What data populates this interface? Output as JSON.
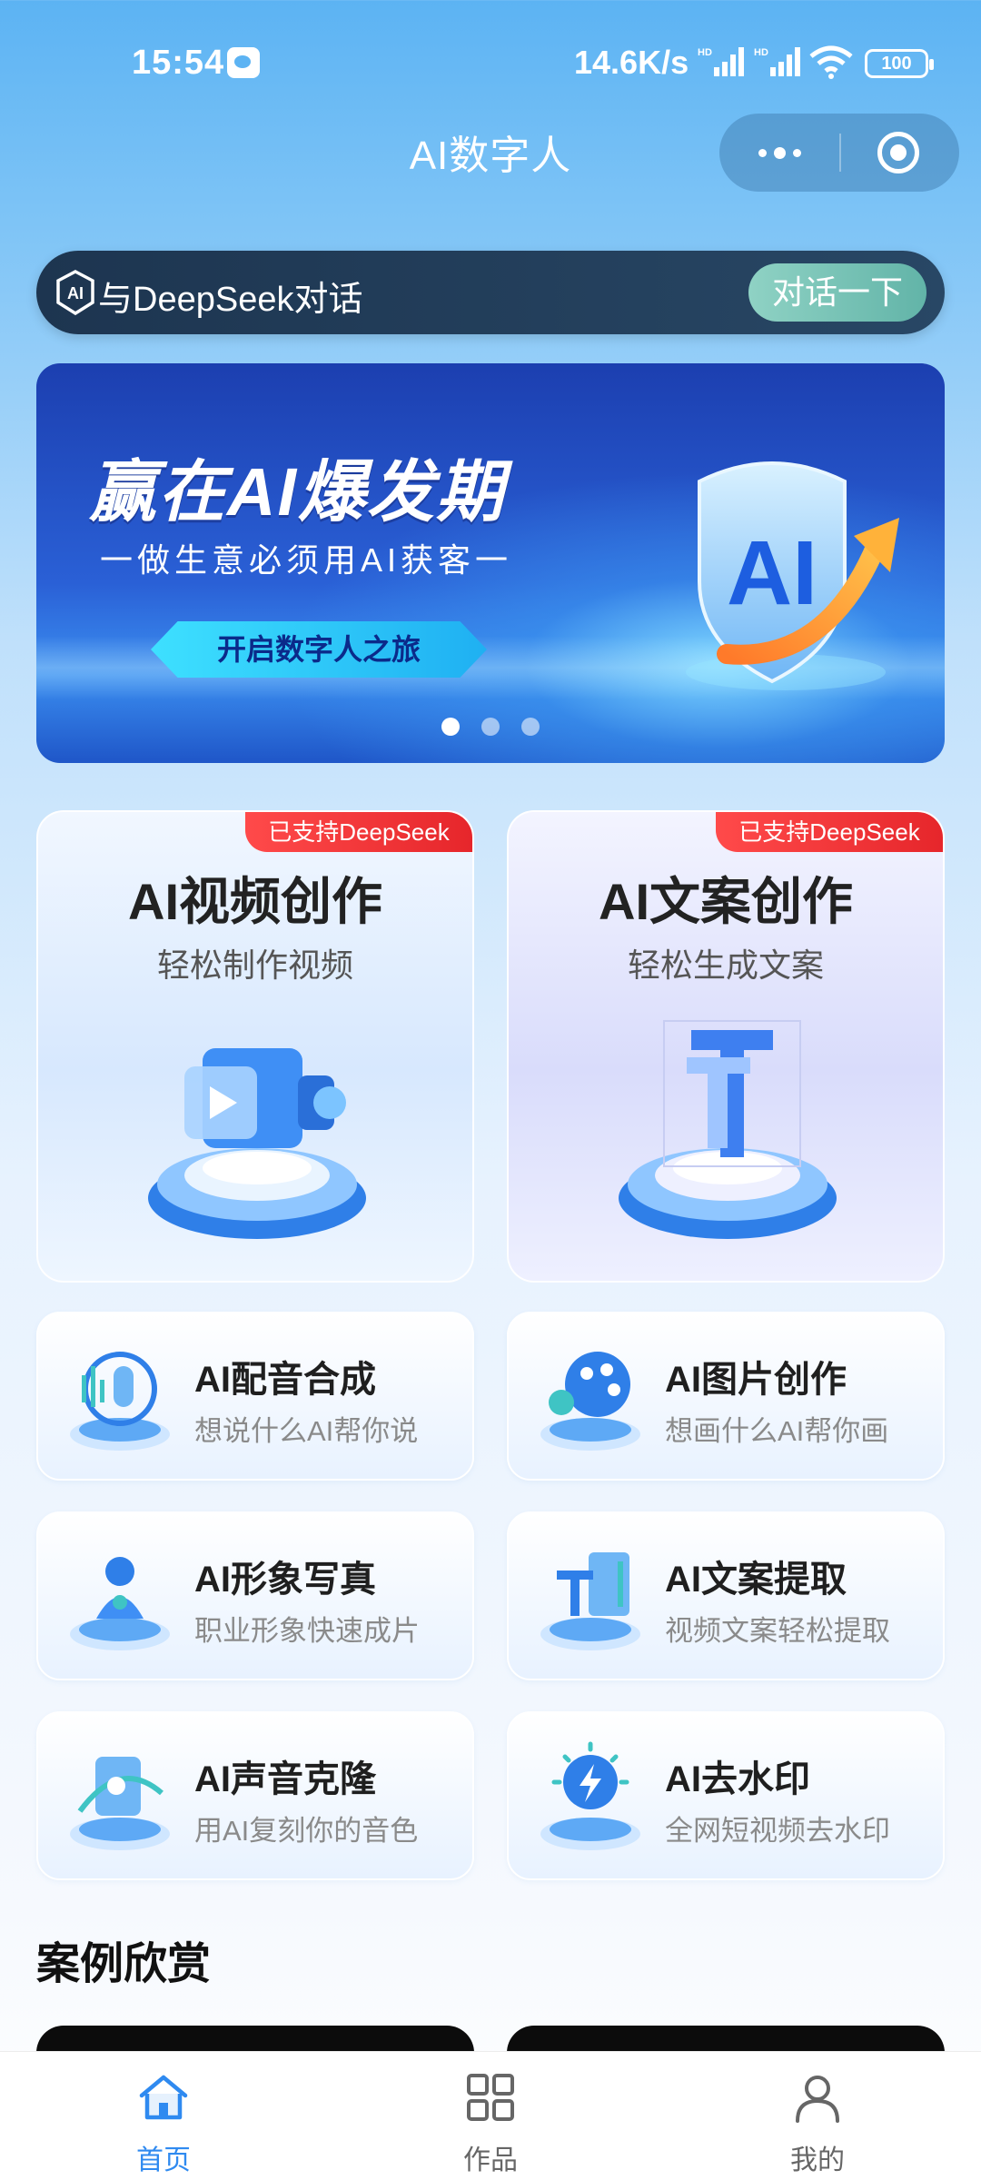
{
  "status_bar": {
    "time": "15:54",
    "net_speed": "14.6K/s",
    "sim1_tag": "HD",
    "sim2_tag": "HD",
    "battery": "100"
  },
  "nav": {
    "title": "AI数字人"
  },
  "deepseek": {
    "label": "与DeepSeek对话",
    "button": "对话一下"
  },
  "banner": {
    "title": "赢在AI爆发期",
    "subtitle": "一做生意必须用AI获客一",
    "button": "开启数字人之旅",
    "shield_text": "AI",
    "page_count": 3,
    "active_page": 1
  },
  "big_cards": [
    {
      "badge": "已支持DeepSeek",
      "title": "AI视频创作",
      "subtitle": "轻松制作视频",
      "icon": "video-camera-icon"
    },
    {
      "badge": "已支持DeepSeek",
      "title": "AI文案创作",
      "subtitle": "轻松生成文案",
      "icon": "text-t-icon"
    }
  ],
  "small_cards": [
    {
      "title": "AI配音合成",
      "subtitle": "想说什么AI帮你说",
      "icon": "microphone-icon"
    },
    {
      "title": "AI图片创作",
      "subtitle": "想画什么AI帮你画",
      "icon": "palette-icon"
    },
    {
      "title": "AI形象写真",
      "subtitle": "职业形象快速成片",
      "icon": "person-icon"
    },
    {
      "title": "AI文案提取",
      "subtitle": "视频文案轻松提取",
      "icon": "text-extract-icon"
    },
    {
      "title": "AI声音克隆",
      "subtitle": "用AI复刻你的音色",
      "icon": "voice-clone-icon"
    },
    {
      "title": "AI去水印",
      "subtitle": "全网短视频去水印",
      "icon": "watermark-remove-icon"
    }
  ],
  "cases": {
    "title": "案例欣赏"
  },
  "tabs": [
    {
      "label": "首页",
      "icon": "home-icon",
      "active": true
    },
    {
      "label": "作品",
      "icon": "grid-icon",
      "active": false
    },
    {
      "label": "我的",
      "icon": "user-icon",
      "active": false
    }
  ],
  "colors": {
    "accent": "#2f8af0",
    "badge_red": "#e6262b",
    "deepseek_bar": "#1d3550",
    "deepseek_button": "#62b4a8"
  }
}
